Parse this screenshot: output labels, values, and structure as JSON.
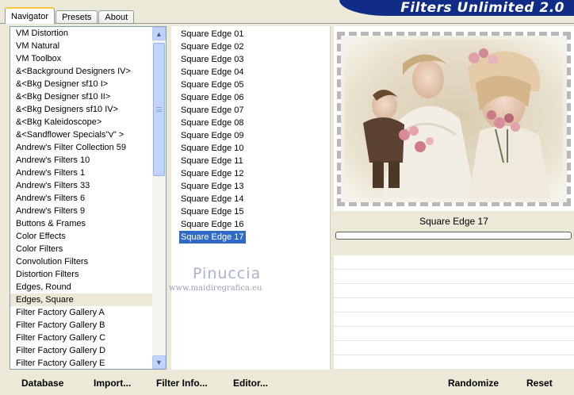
{
  "tabs": [
    {
      "label": "Navigator",
      "active": true
    },
    {
      "label": "Presets",
      "active": false
    },
    {
      "label": "About",
      "active": false
    }
  ],
  "app_title": "Filters Unlimited 2.0",
  "categories": [
    "VM Distortion",
    "VM Natural",
    "VM Toolbox",
    "&<Background Designers IV>",
    "&<Bkg Designer sf10 I>",
    "&<Bkg Designer sf10 II>",
    "&<Bkg Designers sf10 IV>",
    "&<Bkg Kaleidoscope>",
    "&<Sandflower Specials\"v\" >",
    "Andrew's Filter Collection 59",
    "Andrew's Filters 10",
    "Andrew's Filters 1",
    "Andrew's Filters 33",
    "Andrew's Filters 6",
    "Andrew's Filters 9",
    "Buttons & Frames",
    "Color Effects",
    "Color Filters",
    "Convolution Filters",
    "Distortion Filters",
    "Edges, Round",
    "Edges, Square",
    "Filter Factory Gallery A",
    "Filter Factory Gallery B",
    "Filter Factory Gallery C",
    "Filter Factory Gallery D",
    "Filter Factory Gallery E"
  ],
  "selected_category": "Edges, Square",
  "filters": [
    "Square Edge 01",
    "Square Edge 02",
    "Square Edge 03",
    "Square Edge 04",
    "Square Edge 05",
    "Square Edge 06",
    "Square Edge 07",
    "Square Edge 08",
    "Square Edge 09",
    "Square Edge 10",
    "Square Edge 11",
    "Square Edge 12",
    "Square Edge 13",
    "Square Edge 14",
    "Square Edge 15",
    "Square Edge 16",
    "Square Edge 17"
  ],
  "selected_filter": "Square Edge 17",
  "watermark": {
    "name": "Pinuccia",
    "url": "www.maidiregrafica.eu"
  },
  "preview_filter_name": "Square Edge 17",
  "progress": 0,
  "buttons": {
    "database": "Database",
    "import": "Import...",
    "filter_info": "Filter Info...",
    "editor": "Editor...",
    "randomize": "Randomize",
    "reset": "Reset"
  },
  "icons": {
    "scroll_up": "triangle-up-icon",
    "scroll_down": "triangle-down-icon"
  },
  "colors": {
    "header_bg": "#102c86",
    "selection": "#316ac5",
    "window_bg": "#ece9d8"
  }
}
